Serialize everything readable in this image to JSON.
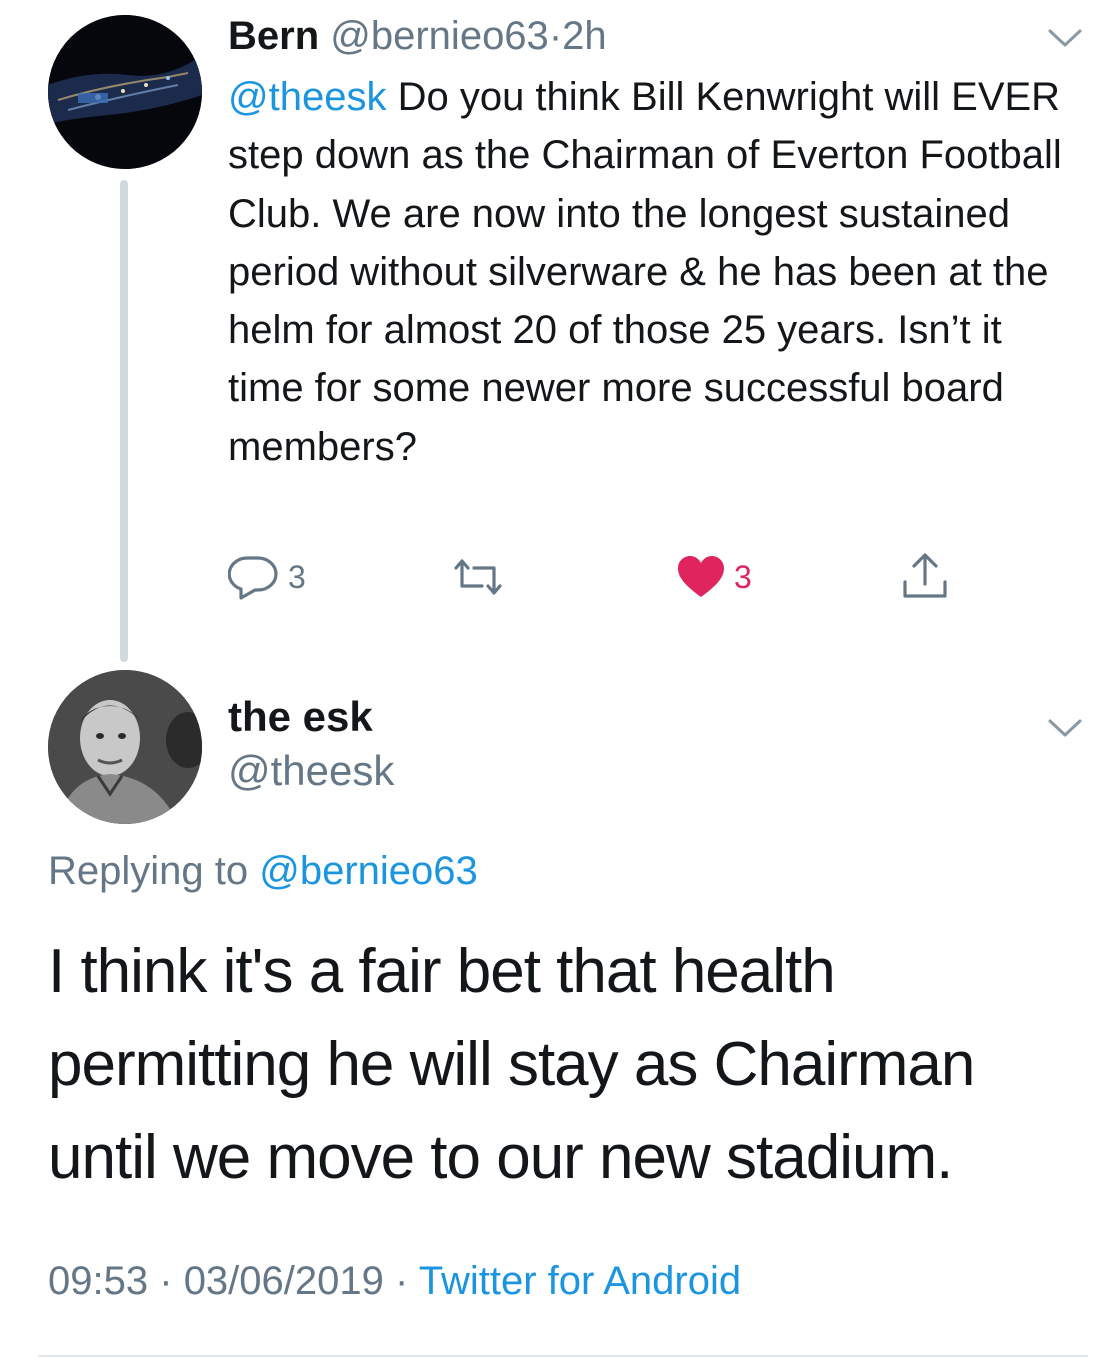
{
  "parent_tweet": {
    "author_name": "Bern",
    "author_handle": "@bernieo63",
    "separator": "·",
    "time_ago": "2h",
    "mention": "@theesk",
    "text": " Do you think Bill Kenwright will EVER step down as the Chairman of Everton Football Club. We are now into the longest sustained period without silverware & he has been at the helm for almost 20 of those 25 years. Isn’t it time for some newer more successful board members?",
    "actions": {
      "reply_count": "3",
      "like_count": "3",
      "liked": true
    }
  },
  "reply_tweet": {
    "author_name": "the esk",
    "author_handle": "@theesk",
    "replying_prefix": "Replying to ",
    "replying_to": "@bernieo63",
    "text": "I think it's a fair bet that health permitting he will stay as Chairman until we move to our new stadium.",
    "time": "09:53",
    "date": "03/06/2019",
    "separator": "·",
    "source": "Twitter for Android"
  },
  "colors": {
    "link": "#1b95e0",
    "secondary_text": "#657786",
    "like": "#e0245e",
    "thread_line": "#cfd9de"
  }
}
